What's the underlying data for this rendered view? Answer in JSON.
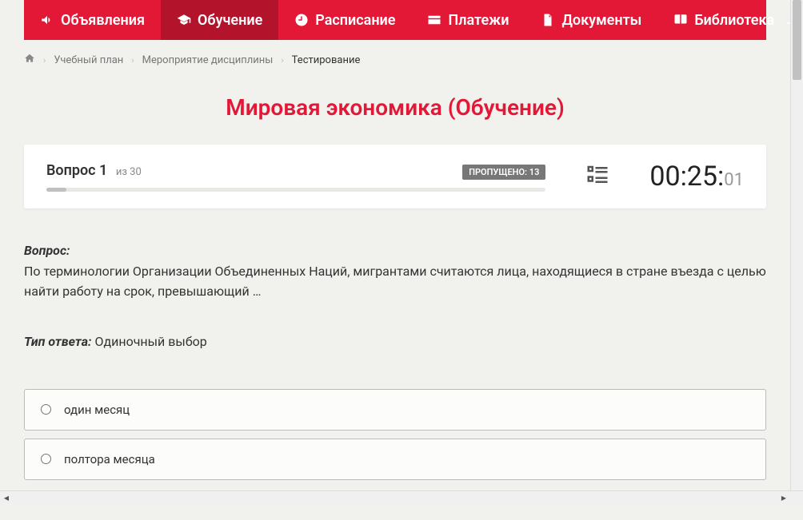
{
  "nav": {
    "items": [
      {
        "label": "Объявления",
        "icon": "megaphone"
      },
      {
        "label": "Обучение",
        "icon": "graduation"
      },
      {
        "label": "Расписание",
        "icon": "clock"
      },
      {
        "label": "Платежи",
        "icon": "card"
      },
      {
        "label": "Документы",
        "icon": "doc"
      },
      {
        "label": "Библиотека",
        "icon": "book"
      }
    ]
  },
  "breadcrumb": {
    "items": [
      "Учебный план",
      "Мероприятие дисциплины"
    ],
    "current": "Тестирование"
  },
  "pageTitle": "Мировая экономика (Обучение)",
  "progress": {
    "questionWord": "Вопрос",
    "current": "1",
    "ofLabel": "из 30",
    "skippedLabel": "ПРОПУЩЕНО: 13"
  },
  "timer": {
    "main": "00:25:",
    "secs": "01"
  },
  "question": {
    "label": "Вопрос:",
    "text": "По терминологии Организации Объединенных Наций, мигрантами считаются лица, находящиеся в стране въезда с целью найти работу на срок, превышающий …"
  },
  "answerType": {
    "label": "Тип ответа:",
    "value": " Одиночный выбор"
  },
  "options": [
    {
      "text": "один месяц"
    },
    {
      "text": "полтора месяца"
    }
  ]
}
